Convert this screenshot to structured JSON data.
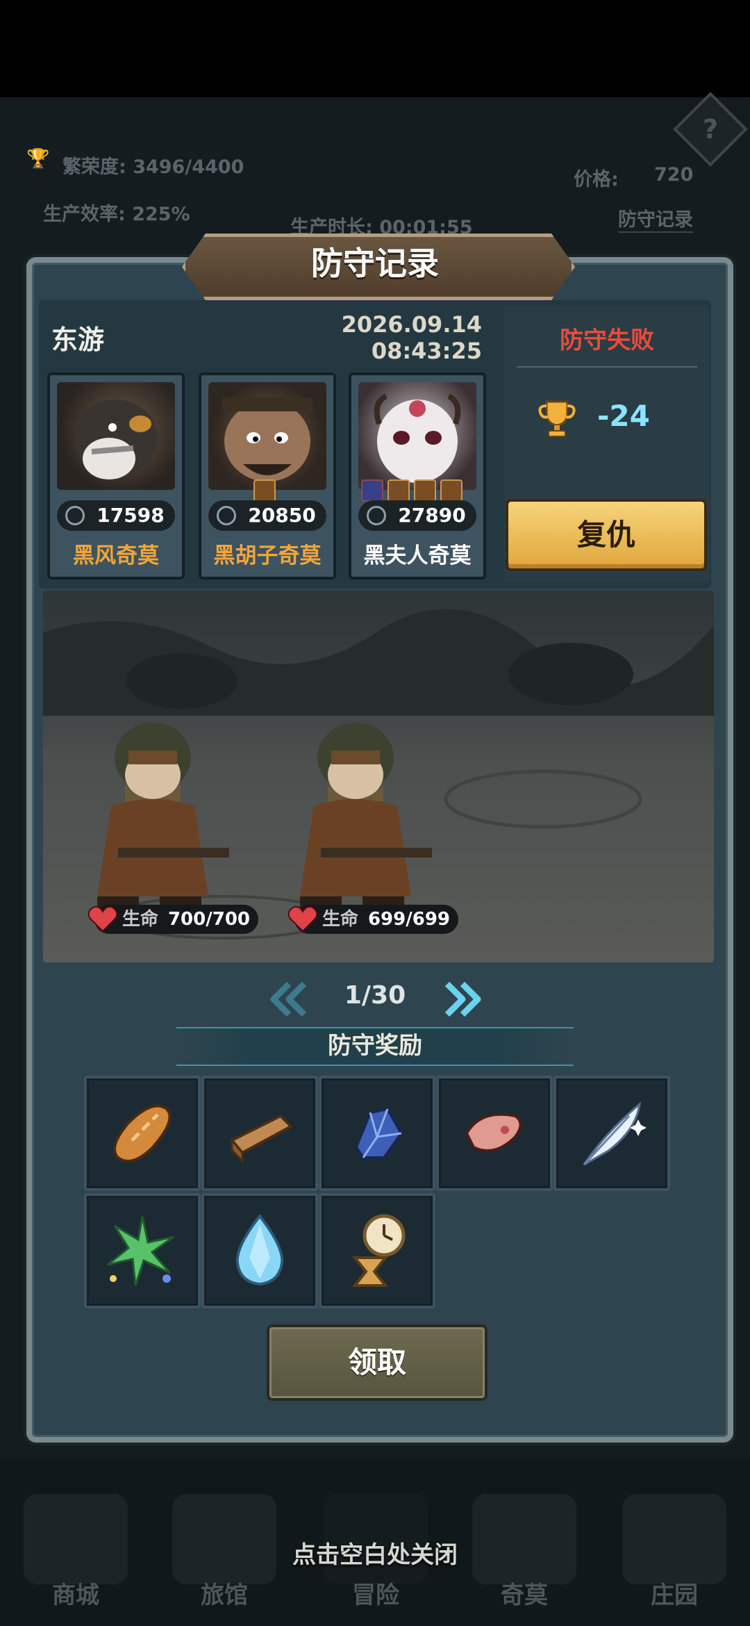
{
  "background": {
    "prosperity": "繁荣度: 3496/4400",
    "efficiency": "生产效率: 225%",
    "production_time": "生产时长: 00:01:55",
    "price_label": "价格:",
    "price_value": "720",
    "records_link": "防守记录",
    "help_icon": "?"
  },
  "bottom_nav": [
    "商城",
    "旅馆",
    "冒险",
    "奇莫",
    "庄园"
  ],
  "close_hint": "点击空白处关闭",
  "dialog": {
    "title": "防守记录",
    "opponent": {
      "name": "东游",
      "date": "2026.09.14",
      "time": "08:43:25"
    },
    "heroes": [
      {
        "name": "黑风奇莫",
        "power": "17598",
        "name_color": "#f2a53a"
      },
      {
        "name": "黑胡子奇莫",
        "power": "20850",
        "name_color": "#f2a53a"
      },
      {
        "name": "黑夫人奇莫",
        "power": "27890",
        "name_color": "#ffffff"
      }
    ],
    "result": {
      "status": "防守失败",
      "trophy_change": "-24",
      "revenge_label": "复仇"
    },
    "defenders": [
      {
        "hp_label": "生命",
        "hp": "700/700"
      },
      {
        "hp_label": "生命",
        "hp": "699/699"
      }
    ],
    "pager": {
      "current": "1/30"
    },
    "rewards": {
      "title": "防守奖励",
      "items": [
        "bread-icon",
        "wood-plank-icon",
        "blue-crystal-icon",
        "pink-petal-icon",
        "feather-quill-icon",
        "green-star-icon",
        "water-drop-gem-icon",
        "hourglass-icon"
      ]
    },
    "claim_label": "领取"
  }
}
